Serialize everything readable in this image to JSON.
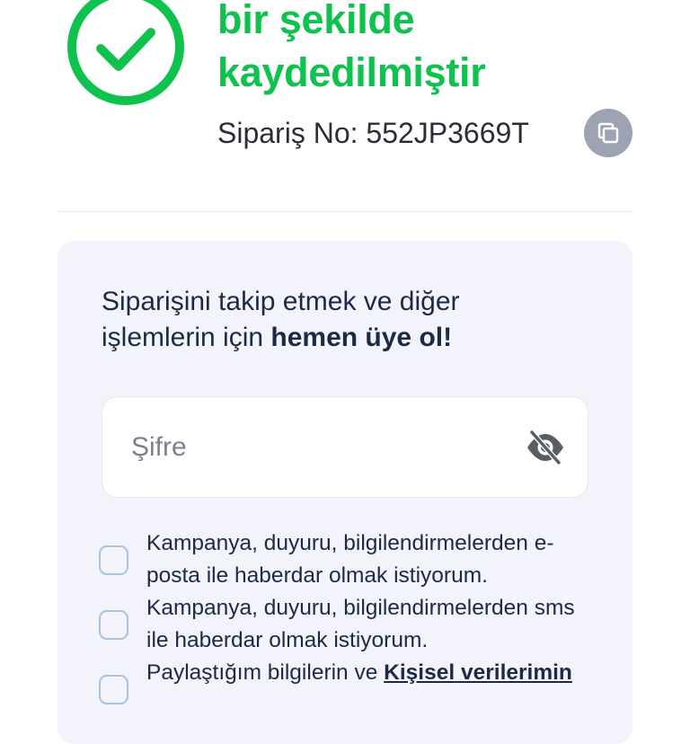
{
  "success": {
    "title_line1": "bir şekilde",
    "title_line2": "kaydedilmiştir",
    "order_label": "Sipariş No: ",
    "order_number": "552JP3669T",
    "accent_color": "#0fc24e"
  },
  "signup": {
    "prompt_prefix": "Siparişini takip etmek ve diğer işlemlerin için ",
    "prompt_bold": "hemen üye ol!",
    "password_placeholder": "Şifre"
  },
  "consents": [
    {
      "text": "Kampanya, duyuru, bilgilendirmelerden e-posta ile haberdar olmak istiyorum."
    },
    {
      "text": "Kampanya, duyuru, bilgilendirmelerden sms ile haberdar olmak istiyorum."
    },
    {
      "text_prefix": "Paylaştığım bilgilerin ve ",
      "link_text": "Kişisel verilerimin"
    }
  ],
  "icons": {
    "success": "check-circle-icon",
    "copy": "copy-icon",
    "password_toggle": "eye-off-icon"
  }
}
